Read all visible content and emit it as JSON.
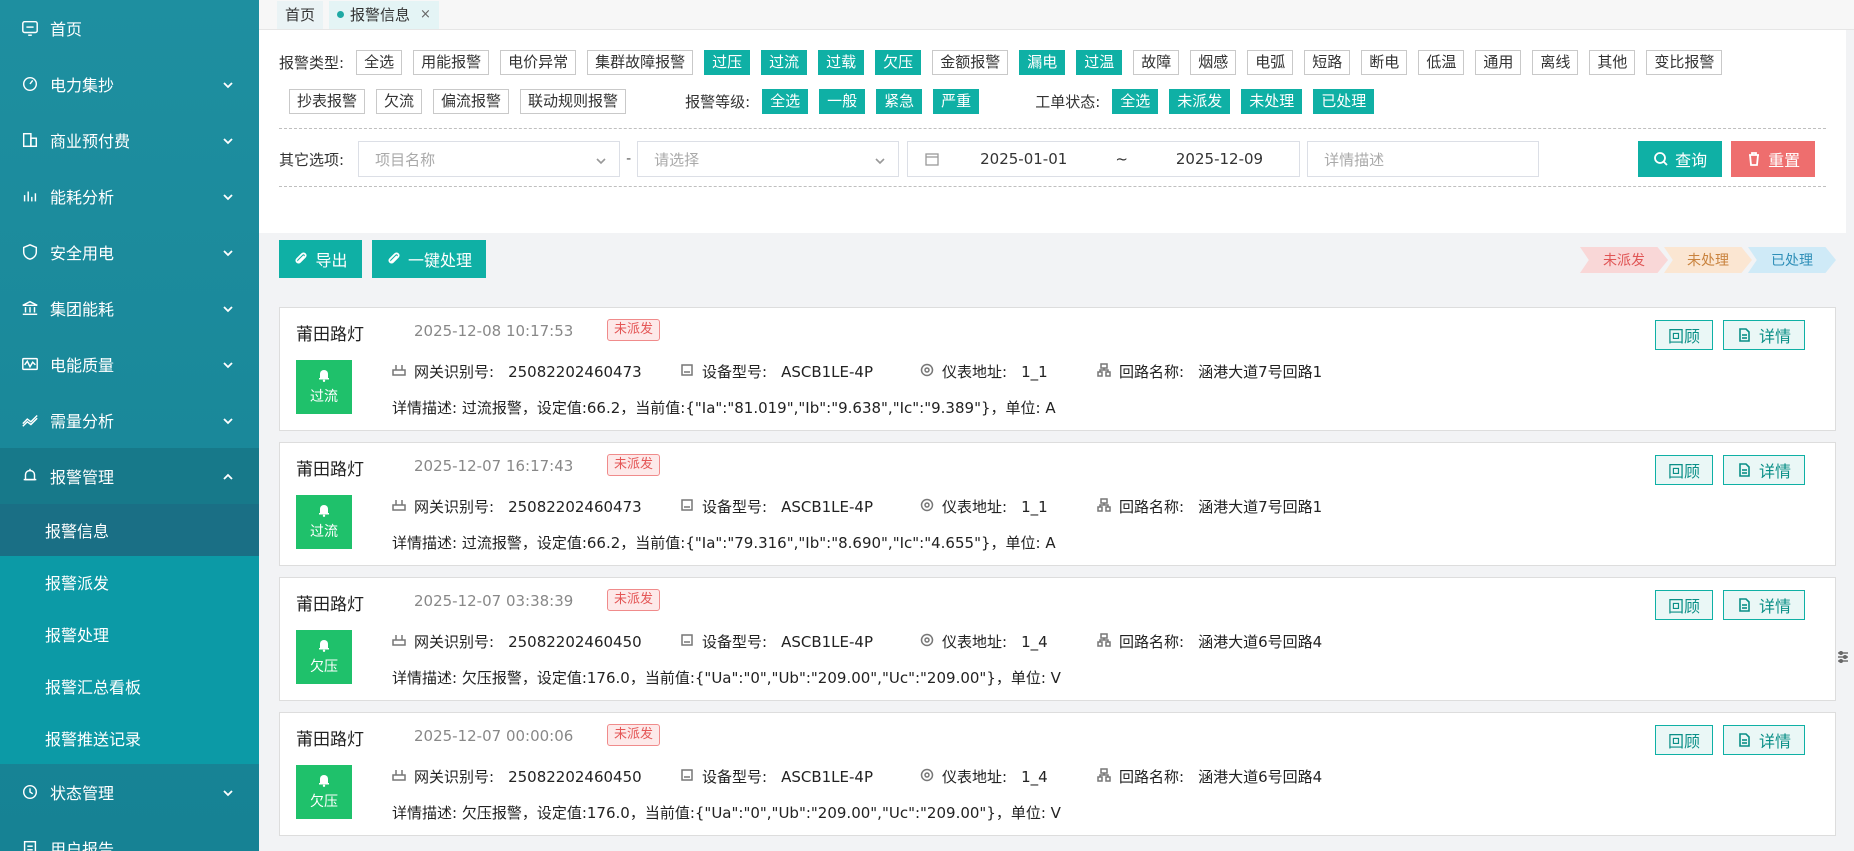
{
  "sidebar": {
    "items": [
      {
        "label": "首页",
        "icon": "dashboard-icon"
      },
      {
        "label": "电力集抄",
        "icon": "meter-icon"
      },
      {
        "label": "商业预付费",
        "icon": "building-icon"
      },
      {
        "label": "能耗分析",
        "icon": "bar-chart-icon"
      },
      {
        "label": "安全用电",
        "icon": "shield-icon"
      },
      {
        "label": "集团能耗",
        "icon": "bank-icon"
      },
      {
        "label": "电能质量",
        "icon": "waveform-icon"
      },
      {
        "label": "需量分析",
        "icon": "trend-icon"
      },
      {
        "label": "报警管理",
        "icon": "bell-icon"
      }
    ],
    "submenu": [
      "报警信息",
      "报警派发",
      "报警处理",
      "报警汇总看板",
      "报警推送记录"
    ],
    "after": [
      {
        "label": "状态管理",
        "icon": "status-icon"
      },
      {
        "label": "用户报告",
        "icon": "report-icon"
      }
    ]
  },
  "tabs": {
    "home": "首页",
    "current": "报警信息",
    "close": "×"
  },
  "filter": {
    "type_label": "报警类型:",
    "types_row1": [
      {
        "label": "全选",
        "on": false
      },
      {
        "label": "用能报警",
        "on": false
      },
      {
        "label": "电价异常",
        "on": false
      },
      {
        "label": "集群故障报警",
        "on": false
      },
      {
        "label": "过压",
        "on": true
      },
      {
        "label": "过流",
        "on": true
      },
      {
        "label": "过载",
        "on": true
      },
      {
        "label": "欠压",
        "on": true
      },
      {
        "label": "金额报警",
        "on": false
      },
      {
        "label": "漏电",
        "on": true
      },
      {
        "label": "过温",
        "on": true
      },
      {
        "label": "故障",
        "on": false
      },
      {
        "label": "烟感",
        "on": false
      },
      {
        "label": "电弧",
        "on": false
      },
      {
        "label": "短路",
        "on": false
      },
      {
        "label": "断电",
        "on": false
      },
      {
        "label": "低温",
        "on": false
      },
      {
        "label": "通用",
        "on": false
      },
      {
        "label": "离线",
        "on": false
      },
      {
        "label": "其他",
        "on": false
      },
      {
        "label": "变比报警",
        "on": false
      }
    ],
    "types_row2": [
      {
        "label": "抄表报警",
        "on": false
      },
      {
        "label": "欠流",
        "on": false
      },
      {
        "label": "偏流报警",
        "on": false
      },
      {
        "label": "联动规则报警",
        "on": false
      }
    ],
    "level_label": "报警等级:",
    "levels": [
      "全选",
      "一般",
      "紧急",
      "严重"
    ],
    "status_label": "工单状态:",
    "statuses": [
      "全选",
      "未派发",
      "未处理",
      "已处理"
    ],
    "other_label": "其它选项:",
    "project_placeholder": "项目名称",
    "dash": "-",
    "select_placeholder": "请选择",
    "date_start": "2025-01-01",
    "date_sep": "~",
    "date_end": "2025-12-09",
    "desc_placeholder": "详情描述",
    "query": "查询",
    "reset": "重置"
  },
  "actions": {
    "export": "导出",
    "process_all": "一键处理"
  },
  "legend": [
    {
      "label": "未派发",
      "bg": "#f9d7d7",
      "color": "#e05555"
    },
    {
      "label": "未处理",
      "bg": "#fbe6d2",
      "color": "#c9833e"
    },
    {
      "label": "已处理",
      "bg": "#cfeaf7",
      "color": "#2f8fb8"
    }
  ],
  "cards": [
    {
      "name": "莆田路灯",
      "time": "2025-12-08 10:17:53",
      "badge": "未派发",
      "alarm": "过流",
      "gw_label": "网关识别号:",
      "gw": "25082202460473",
      "model_label": "设备型号:",
      "model": "ASCB1LE-4P",
      "addr_label": "仪表地址:",
      "addr": "1_1",
      "loop_label": "回路名称:",
      "loop": "涵港大道7号回路1",
      "desc": "详情描述: 过流报警，设定值:66.2，当前值:{\"Ia\":\"81.019\",\"Ib\":\"9.638\",\"Ic\":\"9.389\"}，单位: A",
      "review": "回顾",
      "detail": "详情"
    },
    {
      "name": "莆田路灯",
      "time": "2025-12-07 16:17:43",
      "badge": "未派发",
      "alarm": "过流",
      "gw_label": "网关识别号:",
      "gw": "25082202460473",
      "model_label": "设备型号:",
      "model": "ASCB1LE-4P",
      "addr_label": "仪表地址:",
      "addr": "1_1",
      "loop_label": "回路名称:",
      "loop": "涵港大道7号回路1",
      "desc": "详情描述: 过流报警，设定值:66.2，当前值:{\"Ia\":\"79.316\",\"Ib\":\"8.690\",\"Ic\":\"4.655\"}，单位: A",
      "review": "回顾",
      "detail": "详情"
    },
    {
      "name": "莆田路灯",
      "time": "2025-12-07 03:38:39",
      "badge": "未派发",
      "alarm": "欠压",
      "gw_label": "网关识别号:",
      "gw": "25082202460450",
      "model_label": "设备型号:",
      "model": "ASCB1LE-4P",
      "addr_label": "仪表地址:",
      "addr": "1_4",
      "loop_label": "回路名称:",
      "loop": "涵港大道6号回路4",
      "desc": "详情描述: 欠压报警，设定值:176.0，当前值:{\"Ua\":\"0\",\"Ub\":\"209.00\",\"Uc\":\"209.00\"}，单位: V",
      "review": "回顾",
      "detail": "详情"
    },
    {
      "name": "莆田路灯",
      "time": "2025-12-07 00:00:06",
      "badge": "未派发",
      "alarm": "欠压",
      "gw_label": "网关识别号:",
      "gw": "25082202460450",
      "model_label": "设备型号:",
      "model": "ASCB1LE-4P",
      "addr_label": "仪表地址:",
      "addr": "1_4",
      "loop_label": "回路名称:",
      "loop": "涵港大道6号回路4",
      "desc": "详情描述: 欠压报警，设定值:176.0，当前值:{\"Ua\":\"0\",\"Ub\":\"209.00\",\"Uc\":\"209.00\"}，单位: V",
      "review": "回顾",
      "detail": "详情"
    }
  ]
}
